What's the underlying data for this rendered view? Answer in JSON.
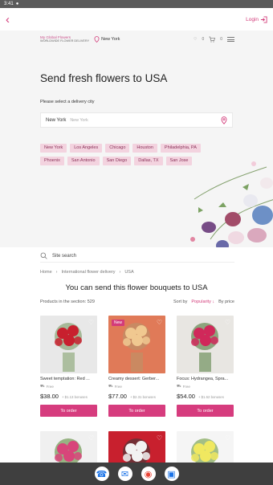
{
  "status": {
    "time": "3:41",
    "notif": "●"
  },
  "topbar": {
    "back_icon": "chevron-left-icon",
    "login_label": "Login"
  },
  "header": {
    "logo_line1": "My Global Flowers",
    "logo_line2": "WORLDWIDE FLOWER DELIVERY",
    "city": "New York",
    "fav_count": "0",
    "cart_count": "0"
  },
  "hero": {
    "title": "Send fresh flowers to USA",
    "city_label": "Please select a delivery city",
    "input_value": "New York",
    "input_placeholder": "New York",
    "cities": [
      "New York",
      "Los Angeles",
      "Chicago",
      "Houston",
      "Philadelphia, PA",
      "Phoenix",
      "San Antonio",
      "San Diego",
      "Dallas, TX",
      "San Jose"
    ]
  },
  "search": {
    "placeholder": "Site search"
  },
  "breadcrumb": [
    "Home",
    "International flower delivery",
    "USA"
  ],
  "section": {
    "title": "You can send this flower bouquets to USA",
    "count_label": "Products in the section: 529",
    "sort_label": "Sort by",
    "sort_popularity": "Popularity ↓",
    "sort_price": "By price"
  },
  "products": [
    {
      "name": "Sweet temptation: Red ...",
      "free": "Free",
      "price": "$38.00",
      "bonus": "+ $1.13 bonuses",
      "button": "To order",
      "badge": "",
      "colors": [
        "#7a9a62",
        "#c8202e",
        "#e8e8e8"
      ]
    },
    {
      "name": "Creamy dessert: Gerber...",
      "free": "Free",
      "price": "$77.00",
      "bonus": "+ $2.31 bonuses",
      "button": "To order",
      "badge": "New",
      "colors": [
        "#b8956a",
        "#f0c890",
        "#e07a58"
      ]
    },
    {
      "name": "Focus: Hydrangea, Spra...",
      "free": "Free",
      "price": "$54.00",
      "bonus": "+ $1.62 bonuses",
      "button": "To order",
      "badge": "",
      "colors": [
        "#4e7a3a",
        "#d0285a",
        "#e8e6e2"
      ]
    }
  ],
  "products_row2": [
    {
      "colors": [
        "#5b8a3a",
        "#d8457a",
        "#f0f0f0"
      ]
    },
    {
      "colors": [
        "#3a3a3a",
        "#f2f2f2",
        "#c8202e"
      ]
    },
    {
      "colors": [
        "#6c9a3c",
        "#f0e860",
        "#f5f5f5"
      ]
    }
  ],
  "dock": [
    {
      "icon": "phone-icon",
      "color": "#1a73e8"
    },
    {
      "icon": "messages-icon",
      "color": "#1a73e8"
    },
    {
      "icon": "chrome-icon",
      "color": "#ea4335"
    },
    {
      "icon": "camera-icon",
      "color": "#1a73e8"
    }
  ],
  "colors": {
    "accent": "#d33b7a",
    "chip_bg": "#f3d3df",
    "hero_bg": "#f5f5f5"
  }
}
